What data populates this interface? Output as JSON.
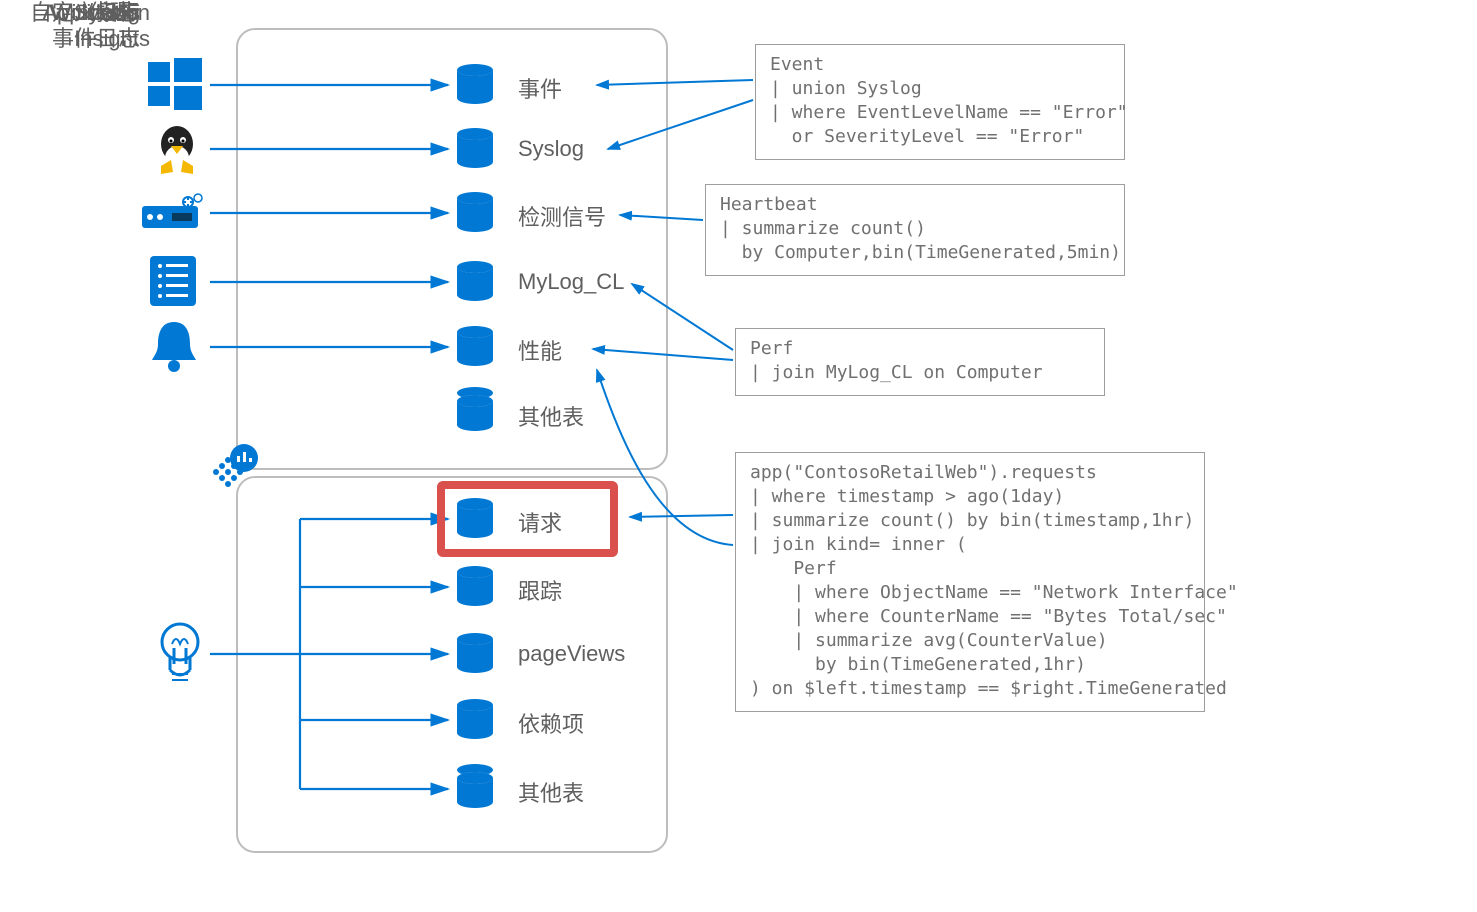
{
  "sources": {
    "windows": {
      "line1": "Windows",
      "line2": "事件日志"
    },
    "syslog": "Syslog",
    "agent": "代理",
    "custom": "自定义日志",
    "metrics": "指标",
    "ai": {
      "line1": "Application",
      "line2": "Insights"
    }
  },
  "tables": {
    "event": "事件",
    "syslog": "Syslog",
    "heartbeat": "检测信号",
    "mylog": "MyLog_CL",
    "perf": "性能",
    "other1": "其他表",
    "requests": "请求",
    "traces": "跟踪",
    "pageviews": "pageViews",
    "deps": "依赖项",
    "other2": "其他表"
  },
  "queries": {
    "q1": "Event\n| union Syslog\n| where EventLevelName == \"Error\"\n  or SeverityLevel == \"Error\"",
    "q2": "Heartbeat\n| summarize count()\n  by Computer,bin(TimeGenerated,5min)",
    "q3": "Perf\n| join MyLog_CL on Computer",
    "q4": "app(\"ContosoRetailWeb\").requests\n| where timestamp > ago(1day)\n| summarize count() by bin(timestamp,1hr)\n| join kind= inner (\n    Perf\n    | where ObjectName == \"Network Interface\"\n    | where CounterName == \"Bytes Total/sec\"\n    | summarize avg(CounterValue)\n      by bin(TimeGenerated,1hr)\n) on $left.timestamp == $right.TimeGenerated"
  }
}
